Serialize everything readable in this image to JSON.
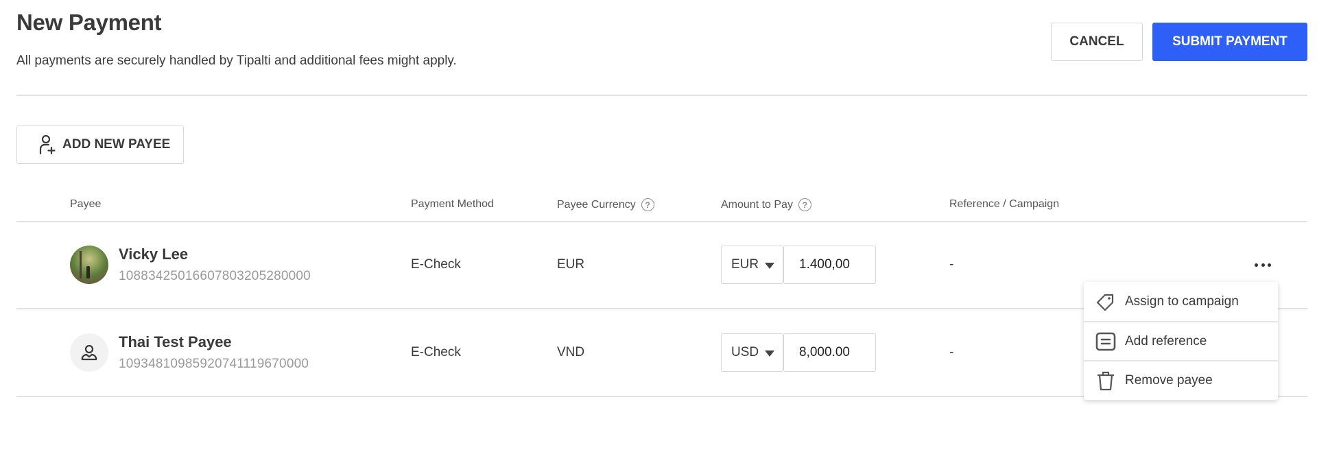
{
  "header": {
    "title": "New Payment",
    "subtitle": "All payments are securely handled by Tipalti and additional fees might apply.",
    "cancel_label": "CANCEL",
    "submit_label": "SUBMIT PAYMENT"
  },
  "colors": {
    "primary": "#2e5ff6",
    "text": "#3a3a3a",
    "muted": "#9a9a9a",
    "border": "#d6d6d6"
  },
  "toolbar": {
    "add_payee_label": "ADD NEW PAYEE",
    "add_payee_icon": "user-plus-icon"
  },
  "table": {
    "columns": [
      {
        "label": "Payee",
        "help": false
      },
      {
        "label": "Payment Method",
        "help": false
      },
      {
        "label": "Payee Currency",
        "help": true
      },
      {
        "label": "Amount to Pay",
        "help": true
      },
      {
        "label": "Reference / Campaign",
        "help": false
      }
    ],
    "help_icon_glyph": "?",
    "rows": [
      {
        "name": "Vicky Lee",
        "id": "1088342501660780320528 0000",
        "id_text": "10883425016607803205280000",
        "avatar": "photo",
        "payment_method": "E-Check",
        "payee_currency": "EUR",
        "amount_currency": "EUR",
        "amount": "1.400,00",
        "reference": "-"
      },
      {
        "name": "Thai Test Payee",
        "id_text": "10934810985920741119670000",
        "avatar": "placeholder-user-icon",
        "payment_method": "E-Check",
        "payee_currency": "VND",
        "amount_currency": "USD",
        "amount": "8,000.00",
        "reference": "-"
      }
    ]
  },
  "row_menu": {
    "trigger_icon": "more-horizontal-icon",
    "items": [
      {
        "label": "Assign to campaign",
        "icon": "tag-icon"
      },
      {
        "label": "Add reference",
        "icon": "reference-icon"
      },
      {
        "label": "Remove payee",
        "icon": "trash-icon"
      }
    ]
  }
}
